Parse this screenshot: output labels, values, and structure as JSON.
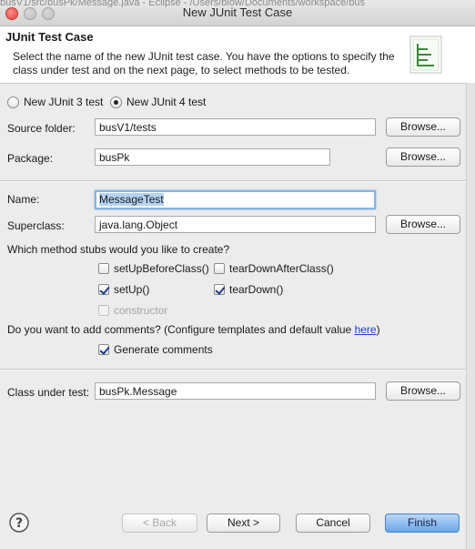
{
  "window": {
    "title": "New JUnit Test Case",
    "background_text": "busV1/src/busPk/Message.java - Eclipse - /Users/blow/Documents/workspace/bus"
  },
  "header": {
    "title": "JUnit Test Case",
    "description": "Select the name of the new JUnit test case. You have the options to specify the class under test and on the next page, to select methods to be tested.",
    "icon": "junit-wizard-icon"
  },
  "version": {
    "junit3_label": "New JUnit 3 test",
    "junit4_label": "New JUnit 4 test",
    "selected": "junit4"
  },
  "source_folder": {
    "label": "Source folder:",
    "value": "busV1/tests",
    "browse": "Browse..."
  },
  "package": {
    "label": "Package:",
    "value": "busPk",
    "browse": "Browse..."
  },
  "name": {
    "label": "Name:",
    "value": "MessageTest"
  },
  "superclass": {
    "label": "Superclass:",
    "value": "java.lang.Object",
    "browse": "Browse..."
  },
  "stubs": {
    "question": "Which method stubs would you like to create?",
    "setUpBeforeClass": {
      "label": "setUpBeforeClass()",
      "checked": false
    },
    "tearDownAfterClass": {
      "label": "tearDownAfterClass()",
      "checked": false
    },
    "setUp": {
      "label": "setUp()",
      "checked": true
    },
    "tearDown": {
      "label": "tearDown()",
      "checked": true
    },
    "constructor": {
      "label": "constructor",
      "checked": false,
      "enabled": false
    }
  },
  "comments": {
    "question": "Do you want to add comments? (Configure templates and default value ",
    "link": "here",
    "question_end": ")",
    "generate": {
      "label": "Generate comments",
      "checked": true
    }
  },
  "class_under_test": {
    "label": "Class under test:",
    "value": "busPk.Message",
    "browse": "Browse..."
  },
  "footer": {
    "help_icon": "help-icon",
    "back": "< Back",
    "next": "Next >",
    "cancel": "Cancel",
    "finish": "Finish"
  },
  "colors": {
    "default_button": "#6aa6e8",
    "link": "#1a3fd1",
    "focus_ring": "#86b3e4"
  }
}
